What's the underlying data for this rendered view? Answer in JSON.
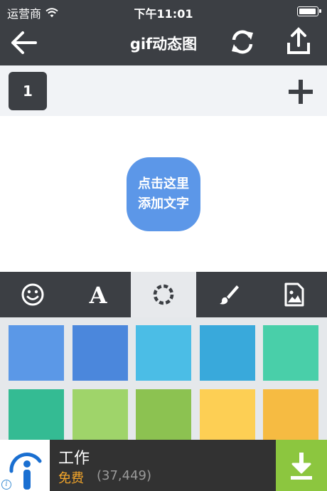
{
  "status_bar": {
    "carrier": "运营商",
    "time": "下午11:01"
  },
  "nav": {
    "title": "gif动态图",
    "icons": [
      "back-arrow-icon",
      "refresh-icon",
      "share-icon"
    ]
  },
  "frames": {
    "tabs": [
      "1"
    ],
    "add_icon": "plus-icon"
  },
  "canvas": {
    "text_bubble_line1": "点击这里",
    "text_bubble_line2": "添加文字",
    "bubble_color": "#5c97e8"
  },
  "tools": {
    "items": [
      "emoji-icon",
      "font-icon",
      "color-ring-icon",
      "brush-icon",
      "image-icon"
    ],
    "active": "color-ring-icon"
  },
  "swatches": {
    "colors": [
      "#5b98e7",
      "#4b87dc",
      "#4bbde6",
      "#39a9db",
      "#49cfa9",
      "#34bb93",
      "#9fd46a",
      "#8cc251",
      "#fdcf54",
      "#f6bb42"
    ]
  },
  "ad": {
    "app_name": "工作",
    "price": "免费",
    "reviews": "(37,449)",
    "download_color": "#8cc63f"
  }
}
